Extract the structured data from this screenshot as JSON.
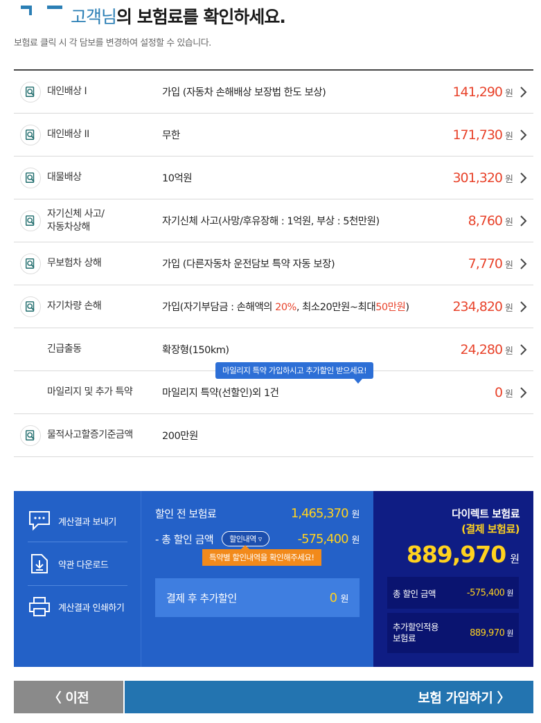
{
  "header": {
    "title_name": "고객님",
    "title_rest": "의 보험료를 확인하세요.",
    "subtitle": "보험료 클릭 시 각 담보를 변경하여 설정할 수 있습니다."
  },
  "coverage": [
    {
      "label": "대인배상 I",
      "desc": "가입 (자동차 손해배상 보장법 한도 보상)",
      "price": "141,290",
      "unit": "원",
      "has_icon": true,
      "has_price": true
    },
    {
      "label": "대인배상 II",
      "desc": "무한",
      "price": "171,730",
      "unit": "원",
      "has_icon": true,
      "has_price": true
    },
    {
      "label": "대물배상",
      "desc": "10억원",
      "price": "301,320",
      "unit": "원",
      "has_icon": true,
      "has_price": true
    },
    {
      "label": "자기신체 사고/\n자동차상해",
      "desc": "자기신체 사고(사망/후유장해 : 1억원, 부상 : 5천만원)",
      "price": "8,760",
      "unit": "원",
      "has_icon": true,
      "has_price": true
    },
    {
      "label": "무보험차 상해",
      "desc": "가입 (다른자동차 운전담보 특약 자동 보장)",
      "price": "7,770",
      "unit": "원",
      "has_icon": true,
      "has_price": true
    },
    {
      "label": "자기차량 손해",
      "desc_parts": [
        "가입(자기부담금 : 손해액의 ",
        "20%",
        ", 최소20만원~최대",
        "50만원",
        ")"
      ],
      "price": "234,820",
      "unit": "원",
      "has_icon": true,
      "has_price": true
    },
    {
      "label": "긴급출동",
      "desc": "확장형(150km)",
      "price": "24,280",
      "unit": "원",
      "has_icon": false,
      "has_price": true
    },
    {
      "label": "마일리지 및 추가 특약",
      "desc": "마일리지 특약(선할인)외 1건",
      "price": "0",
      "unit": "원",
      "has_icon": false,
      "has_price": true
    },
    {
      "label": "물적사고할증기준금액",
      "desc": "200만원",
      "has_icon": true,
      "has_price": false
    }
  ],
  "mileage_tooltip": "마일리지 특약 가입하시고 추가할인 받으세요!",
  "actions": {
    "send": "계산결과 보내기",
    "download": "약관 다운로드",
    "print": "계산결과 인쇄하기"
  },
  "summary": {
    "before_label": "할인 전 보험료",
    "before_value": "1,465,370",
    "discount_label": "- 총 할인 금액",
    "discount_pill": "할인내역",
    "discount_value": "-575,400",
    "discount_tooltip": "특약별 할인내역을 확인해주세요!",
    "after_label": "결제 후 추가할인",
    "after_value": "0",
    "unit": "원"
  },
  "direct": {
    "title": "다이렉트 보험료",
    "subtitle": "(결제 보험료)",
    "amount": "889,970",
    "unit": "원",
    "total_discount_label": "총 할인 금액",
    "total_discount_value": "-575,400",
    "extra_label": "추가할인적용\n보험료",
    "extra_value": "889,970"
  },
  "buttons": {
    "prev": "〈 이전",
    "next": "보험 가입하기 〉"
  },
  "colors": {
    "accent_blue": "#2b7fb5",
    "price_red": "#e8432b",
    "highlight_yellow": "#ffd21f",
    "summary_blue": "#2461c8",
    "direct_navy": "#0f1d84"
  }
}
